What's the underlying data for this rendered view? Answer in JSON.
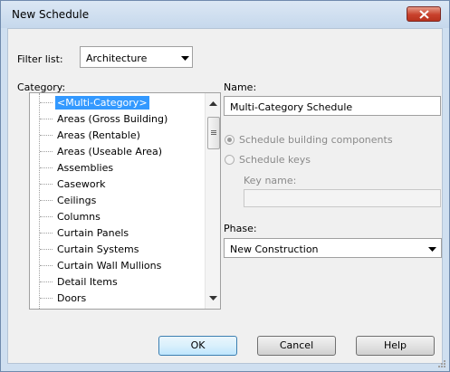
{
  "window": {
    "title": "New Schedule"
  },
  "filter": {
    "label": "Filter list:",
    "value": "Architecture"
  },
  "category": {
    "label": "Category:",
    "items": [
      "<Multi-Category>",
      "Areas (Gross Building)",
      "Areas (Rentable)",
      "Areas (Useable Area)",
      "Assemblies",
      "Casework",
      "Ceilings",
      "Columns",
      "Curtain Panels",
      "Curtain Systems",
      "Curtain Wall Mullions",
      "Detail Items",
      "Doors"
    ],
    "selected_index": 0
  },
  "name": {
    "label": "Name:",
    "value": "Multi-Category Schedule"
  },
  "options": {
    "schedule_components": "Schedule building components",
    "schedule_keys": "Schedule keys",
    "key_name_label": "Key name:",
    "key_name_value": ""
  },
  "phase": {
    "label": "Phase:",
    "value": "New Construction"
  },
  "buttons": {
    "ok": "OK",
    "cancel": "Cancel",
    "help": "Help"
  },
  "colors": {
    "selection": "#3399ff",
    "close_button": "#c8412c"
  }
}
